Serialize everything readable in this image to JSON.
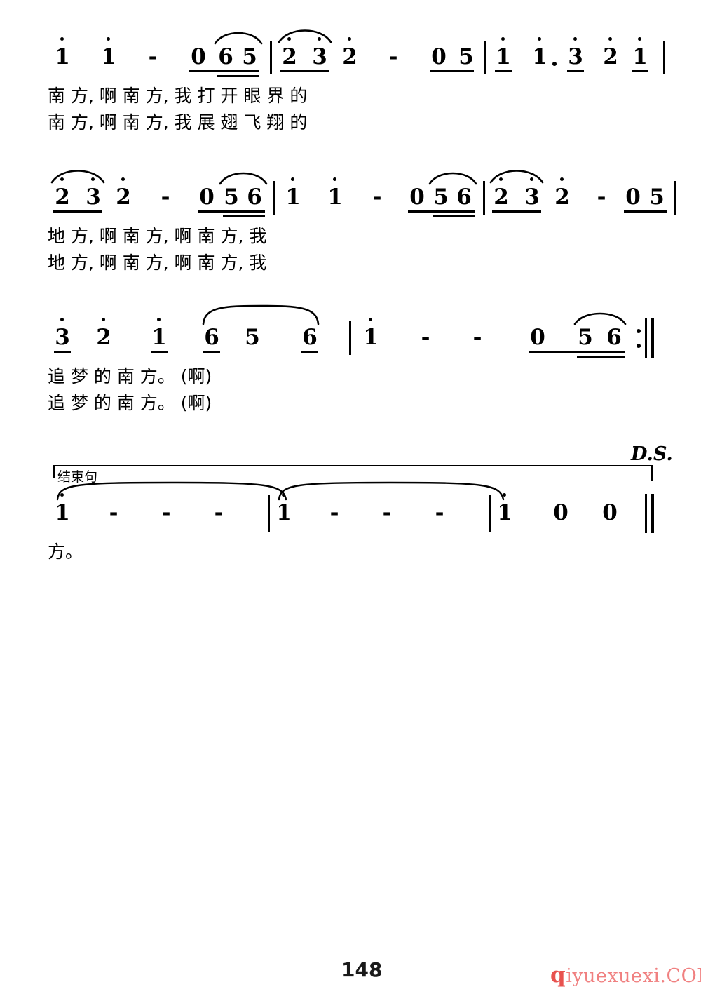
{
  "document": {
    "type": "jianpu-numbered-notation-sheet-music",
    "page_number": "148",
    "watermark": {
      "lead": "q",
      "rest": "iyuexuexi.COM",
      "color": "#ee5f5b"
    }
  },
  "markings": {
    "dal_segno": "D.S.",
    "ending_phrase_label": "结束句"
  },
  "systems": [
    {
      "id": "system-1",
      "notes": [
        {
          "glyph": "1",
          "octave_up": 1,
          "beams": 0
        },
        {
          "glyph": "1",
          "octave_up": 1,
          "beams": 0
        },
        {
          "glyph": "-",
          "dash": true
        },
        {
          "glyph": "0",
          "beams": 1
        },
        {
          "glyph": "6",
          "beams": 2
        },
        {
          "glyph": "5",
          "beams": 2
        },
        {
          "glyph": "2",
          "octave_up": 1,
          "beams": 1
        },
        {
          "glyph": "3",
          "octave_up": 1,
          "beams": 1
        },
        {
          "glyph": "2",
          "octave_up": 1,
          "beams": 0
        },
        {
          "glyph": "-",
          "dash": true
        },
        {
          "glyph": "0",
          "beams": 1
        },
        {
          "glyph": "5",
          "beams": 1
        },
        {
          "glyph": "1",
          "octave_up": 1,
          "beams": 1
        },
        {
          "glyph": "1",
          "octave_up": 1,
          "beams": 0,
          "dotted": true
        },
        {
          "glyph": "3",
          "octave_up": 1,
          "beams": 1
        },
        {
          "glyph": "2",
          "octave_up": 1,
          "beams": 0
        },
        {
          "glyph": "1",
          "octave_up": 1,
          "beams": 1
        }
      ],
      "lyrics_row1": "南 方,   啊 南 方,   我 打 开 眼 界 的",
      "lyrics_row2": "南 方,   啊 南 方,   我 展 翅 飞 翔 的"
    },
    {
      "id": "system-2",
      "notes": [
        {
          "glyph": "2",
          "octave_up": 1,
          "beams": 1
        },
        {
          "glyph": "3",
          "octave_up": 1,
          "beams": 1
        },
        {
          "glyph": "2",
          "octave_up": 1,
          "beams": 0
        },
        {
          "glyph": "-",
          "dash": true
        },
        {
          "glyph": "0",
          "beams": 1
        },
        {
          "glyph": "5",
          "beams": 2
        },
        {
          "glyph": "6",
          "beams": 2
        },
        {
          "glyph": "1",
          "octave_up": 1,
          "beams": 0
        },
        {
          "glyph": "1",
          "octave_up": 1,
          "beams": 0
        },
        {
          "glyph": "-",
          "dash": true
        },
        {
          "glyph": "0",
          "beams": 1
        },
        {
          "glyph": "5",
          "beams": 2
        },
        {
          "glyph": "6",
          "beams": 2
        },
        {
          "glyph": "2",
          "octave_up": 1,
          "beams": 1
        },
        {
          "glyph": "3",
          "octave_up": 1,
          "beams": 1
        },
        {
          "glyph": "2",
          "octave_up": 1,
          "beams": 0
        },
        {
          "glyph": "-",
          "dash": true
        },
        {
          "glyph": "0",
          "beams": 1
        },
        {
          "glyph": "5",
          "beams": 1
        }
      ],
      "lyrics_row1": "地 方,   啊 南 方,   啊 南 方,   我",
      "lyrics_row2": "地 方,   啊 南 方,   啊 南 方,   我"
    },
    {
      "id": "system-3",
      "notes": [
        {
          "glyph": "3",
          "octave_up": 1,
          "beams": 1
        },
        {
          "glyph": "2",
          "octave_up": 1,
          "beams": 0
        },
        {
          "glyph": "1",
          "octave_up": 1,
          "beams": 1
        },
        {
          "glyph": "6",
          "beams": 1
        },
        {
          "glyph": "5",
          "beams": 0
        },
        {
          "glyph": "6",
          "beams": 1
        },
        {
          "glyph": "1",
          "octave_up": 1,
          "beams": 0
        },
        {
          "glyph": "-",
          "dash": true
        },
        {
          "glyph": "-",
          "dash": true
        },
        {
          "glyph": "0",
          "beams": 1
        },
        {
          "glyph": "5",
          "beams": 2
        },
        {
          "glyph": "6",
          "beams": 2
        }
      ],
      "lyrics_row1": "追 梦 的 南   方。      (啊)",
      "lyrics_row2": "追 梦 的 南   方。      (啊)",
      "repeat_end": true
    },
    {
      "id": "system-4",
      "notes": [
        {
          "glyph": "1",
          "octave_up": 1,
          "beams": 0
        },
        {
          "glyph": "-",
          "dash": true
        },
        {
          "glyph": "-",
          "dash": true
        },
        {
          "glyph": "-",
          "dash": true
        },
        {
          "glyph": "1",
          "octave_up": 1,
          "beams": 0
        },
        {
          "glyph": "-",
          "dash": true
        },
        {
          "glyph": "-",
          "dash": true
        },
        {
          "glyph": "-",
          "dash": true
        },
        {
          "glyph": "1",
          "octave_up": 1,
          "beams": 0
        },
        {
          "glyph": "0",
          "beams": 0
        },
        {
          "glyph": "0",
          "beams": 0
        }
      ],
      "lyrics_row1": "方。",
      "final_double_bar": true
    }
  ]
}
